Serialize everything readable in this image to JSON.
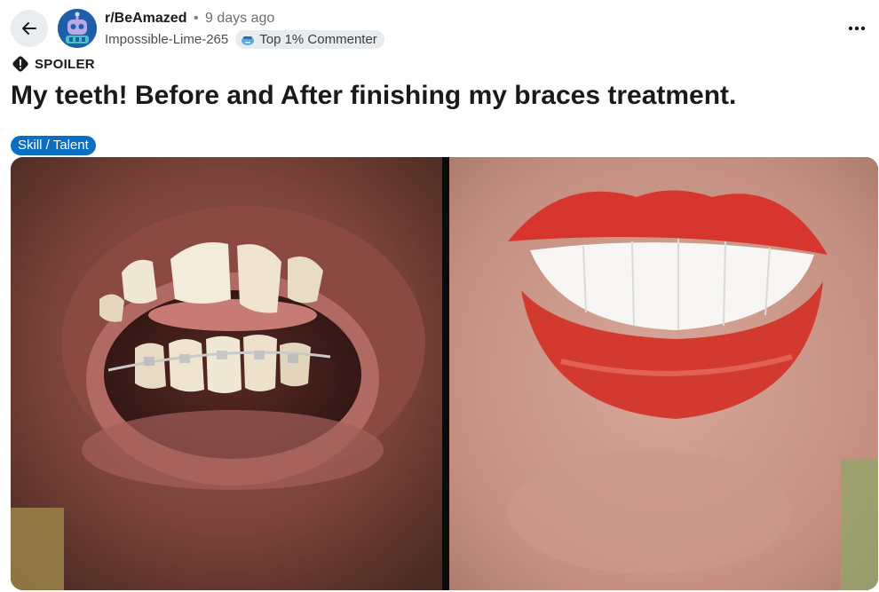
{
  "header": {
    "subreddit": "r/BeAmazed",
    "separator": "•",
    "time_ago": "9 days ago",
    "author": "Impossible-Lime-265",
    "author_flair": "Top 1% Commenter"
  },
  "post": {
    "spoiler_label": "SPOILER",
    "title": "My teeth! Before and After finishing my braces treatment.",
    "flair_tag": "Skill / Talent"
  },
  "icons": {
    "back": "arrow-left-icon",
    "more": "more-horizontal-icon",
    "spoiler": "alert-icon",
    "flair": "commenter-badge-icon",
    "avatar": "subreddit-robot-icon"
  },
  "colors": {
    "tag_bg": "#0a6fc2",
    "button_bg": "#eaedef",
    "flair_bg": "#e8ecef",
    "avatar_bg": "#1f5ea8"
  }
}
